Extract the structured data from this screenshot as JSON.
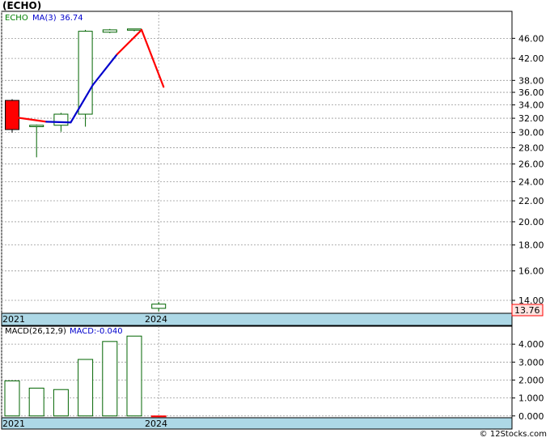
{
  "header": {
    "title": "(ECHO)"
  },
  "footer": {
    "credit": "© 12Stocks.com"
  },
  "colors": {
    "up": "#006400",
    "down": "#ff0000",
    "ma_up": "#0000cc",
    "ma_down": "#ff0000",
    "timebar": "#add8e6",
    "price_tag": "#ffe4e1"
  },
  "chart_data": [
    {
      "type": "candlestick",
      "legend": {
        "ticker": "ECHO",
        "ma_label": "MA(3)",
        "ma_value": "36.74"
      },
      "x_labels": [
        "2021",
        "2024"
      ],
      "ylim": [
        13.2,
        52.0
      ],
      "y_scale": "log",
      "y_ticks": [
        14,
        16,
        18,
        20,
        22,
        24,
        26,
        28,
        30,
        32,
        34,
        36,
        38,
        42,
        46
      ],
      "y_tick_labels": [
        "14.00",
        "16.00",
        "18.00",
        "20.00",
        "22.00",
        "24.00",
        "26.00",
        "28.00",
        "30.00",
        "32.00",
        "34.00",
        "36.00",
        "38.00",
        "42.00",
        "46.00"
      ],
      "last_price": "13.76",
      "candles": [
        {
          "open": 34.7,
          "high": 34.9,
          "low": 30.0,
          "close": 30.4
        },
        {
          "open": 30.8,
          "high": 31.1,
          "low": 26.8,
          "close": 31.0
        },
        {
          "open": 31.0,
          "high": 32.8,
          "low": 30.1,
          "close": 32.6
        },
        {
          "open": 32.6,
          "high": 47.8,
          "low": 30.8,
          "close": 47.5
        },
        {
          "open": 47.3,
          "high": 48.0,
          "low": 47.1,
          "close": 47.8
        },
        {
          "open": 47.8,
          "high": 48.0,
          "low": 47.5,
          "close": 48.0
        },
        {
          "open": 13.5,
          "high": 13.9,
          "low": 13.3,
          "close": 13.76
        }
      ],
      "ma_line": [
        {
          "i": 0,
          "value": 32.2,
          "dir": "down"
        },
        {
          "i": 1.4,
          "value": 31.5,
          "dir": "down"
        },
        {
          "i": 2.4,
          "value": 31.4,
          "dir": "up"
        },
        {
          "i": 3.3,
          "value": 37.2,
          "dir": "up"
        },
        {
          "i": 4.3,
          "value": 42.8,
          "dir": "up"
        },
        {
          "i": 5.3,
          "value": 47.8,
          "dir": "down"
        },
        {
          "i": 6.2,
          "value": 36.9,
          "dir": "down"
        }
      ]
    },
    {
      "type": "bar",
      "legend": {
        "label": "MACD(26,12,9)",
        "value_label": "MACD:-0.040"
      },
      "x_labels": [
        "2021",
        "2024"
      ],
      "ylim": [
        -0.1,
        5.0
      ],
      "y_ticks": [
        0,
        1,
        2,
        3,
        4
      ],
      "y_tick_labels": [
        "0.000",
        "1.000",
        "2.000",
        "3.000",
        "4.000"
      ],
      "values": [
        1.95,
        1.55,
        1.47,
        3.15,
        4.15,
        4.45,
        -0.04
      ]
    }
  ]
}
